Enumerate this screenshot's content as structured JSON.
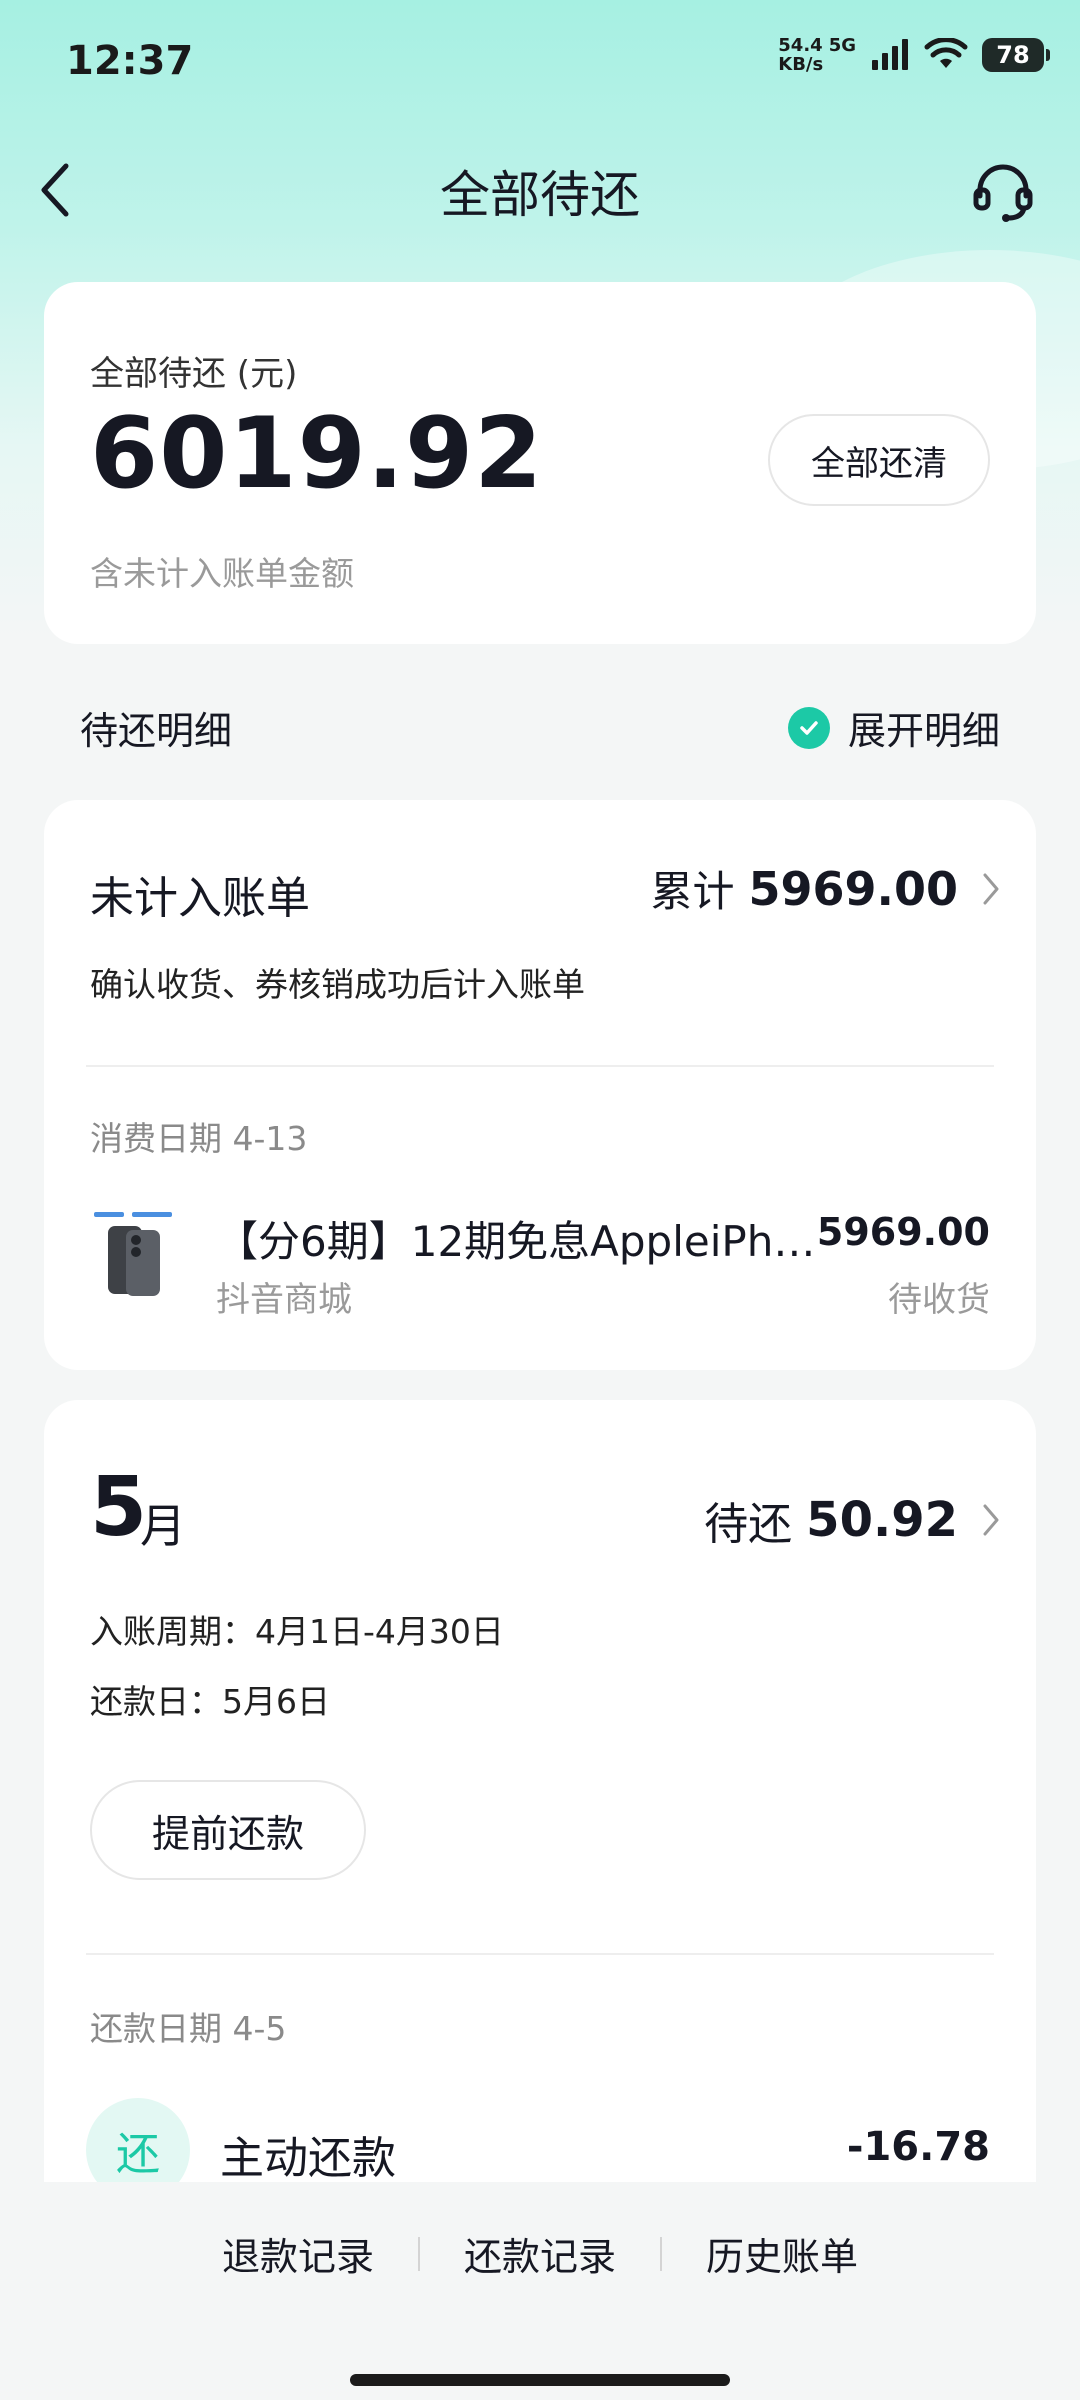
{
  "status_bar": {
    "time": "12:37",
    "net_speed_value": "54.4",
    "net_speed_unit": "KB/s",
    "network_type": "5G",
    "battery": "78"
  },
  "nav": {
    "title": "全部待还"
  },
  "summary": {
    "label": "全部待还 (元)",
    "amount": "6019.92",
    "note": "含未计入账单金额",
    "pay_all_label": "全部还清"
  },
  "detail_header": {
    "title": "待还明细",
    "expand_label": "展开明细"
  },
  "unbilled": {
    "title": "未计入账单",
    "total_label": "累计",
    "total_value": "5969.00",
    "description": "确认收货、券核销成功后计入账单",
    "date_label": "消费日期 4-13",
    "item": {
      "title": "【分6期】12期免息AppleiPh…",
      "shop": "抖音商城",
      "amount": "5969.00",
      "status": "待收货"
    }
  },
  "month_bill": {
    "month": "5",
    "month_unit": "月",
    "due_label": "待还",
    "due_value": "50.92",
    "cycle": "入账周期：4月1日-4月30日",
    "repay_day": "还款日：5月6日",
    "prepay_label": "提前还款",
    "repay_date_label": "还款日期 4-5",
    "repay_icon_text": "还",
    "repay_title": "主动还款",
    "repay_amount": "-16.78"
  },
  "bottom_links": {
    "refund_records": "退款记录",
    "repay_records": "还款记录",
    "history_bills": "历史账单"
  },
  "colors": {
    "accent": "#1cc9a6",
    "header_gradient_top": "#a6f0e2",
    "background": "#f4f6f6"
  }
}
